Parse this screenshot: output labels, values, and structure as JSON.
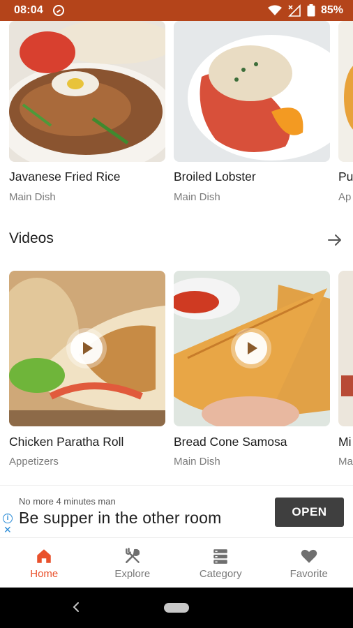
{
  "status_bar": {
    "time": "08:04",
    "battery": "85%",
    "icons": [
      "do-not-disturb-icon",
      "wifi-icon",
      "signal-icon",
      "battery-icon"
    ]
  },
  "recipes": [
    {
      "title": "Javanese Fried Rice",
      "category": "Main Dish"
    },
    {
      "title": "Broiled Lobster",
      "category": "Main Dish"
    },
    {
      "title": "Pu",
      "category": "Ap"
    }
  ],
  "videos_section": {
    "title": "Videos",
    "arrow_icon": "arrow-right-icon",
    "items": [
      {
        "title": "Chicken Paratha Roll",
        "category": "Appetizers"
      },
      {
        "title": "Bread Cone Samosa",
        "category": "Main Dish"
      },
      {
        "title": "Mi",
        "category": "Ma"
      }
    ]
  },
  "ad": {
    "small_text": "No more 4 minutes man",
    "headline": "Be supper in the other room",
    "button": "OPEN"
  },
  "bottom_nav": {
    "items": [
      {
        "label": "Home",
        "icon": "home-icon",
        "active": true
      },
      {
        "label": "Explore",
        "icon": "fork-knife-icon",
        "active": false
      },
      {
        "label": "Category",
        "icon": "category-icon",
        "active": false
      },
      {
        "label": "Favorite",
        "icon": "heart-icon",
        "active": false
      }
    ]
  },
  "colors": {
    "status_bar": "#b4441a",
    "accent": "#e9512c"
  }
}
